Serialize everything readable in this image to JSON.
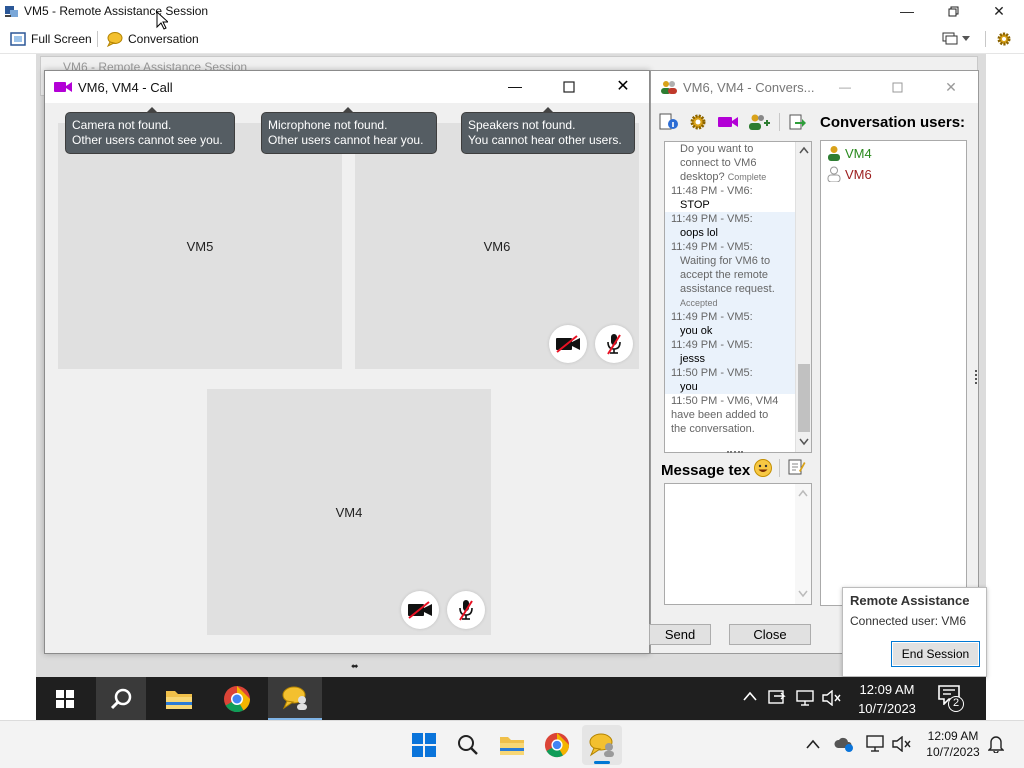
{
  "host_window": {
    "title": "VM5 - Remote Assistance Session",
    "toolbar": {
      "full_screen_label": "Full Screen",
      "conversation_label": "Conversation"
    }
  },
  "bg_window": {
    "title": "VM6 - Remote Assistance Session"
  },
  "call_window": {
    "title": "VM6, VM4 - Call",
    "tooltips": [
      {
        "line1": "Camera not found.",
        "line2": "Other users cannot see you."
      },
      {
        "line1": "Microphone not found.",
        "line2": "Other users cannot hear you."
      },
      {
        "line1": "Speakers not found.",
        "line2": "You cannot hear other users."
      }
    ],
    "tiles": {
      "vm5": "VM5",
      "vm6": "VM6",
      "vm4": "VM4"
    }
  },
  "conversation_window": {
    "title": "VM6, VM4 - Convers...",
    "users_heading": "Conversation users:",
    "users": [
      {
        "name": "VM4",
        "color": "#2a8a1e"
      },
      {
        "name": "VM6",
        "color": "#9b1c1c"
      }
    ],
    "chat": {
      "l1": "Do you want to",
      "l2": "connect to VM6",
      "l3": "desktop?",
      "l3_status": "Complete",
      "h1": "11:48 PM - VM6:",
      "m1": "STOP",
      "h2": "11:49 PM - VM5:",
      "m2": "oops lol",
      "h3": "11:49 PM - VM5:",
      "w1": "Waiting for VM6 to",
      "w2": "accept the remote",
      "w3": "assistance request.",
      "w_status": "Accepted",
      "h4": "11:49 PM - VM5:",
      "m4": "you ok",
      "h5": "11:49 PM - VM5:",
      "m5": "jesss",
      "h6": "11:50 PM - VM5:",
      "m6": "you",
      "s1": "11:50 PM - VM6, VM4",
      "s2": "have been added to",
      "s3": "the conversation."
    },
    "message_label": "Message tex",
    "send_label": "Send",
    "close_label": "Close"
  },
  "ra_popup": {
    "title": "Remote Assistance",
    "connected_text": "Connected user: VM6",
    "end_session_label": "End Session"
  },
  "remote_taskbar": {
    "time": "12:09 AM",
    "date": "10/7/2023",
    "notification_count": "2"
  },
  "host_taskbar": {
    "time": "12:09 AM",
    "date": "10/7/2023"
  },
  "colors": {
    "camera_icon": "#b300d6",
    "accent": "#0078d4"
  }
}
